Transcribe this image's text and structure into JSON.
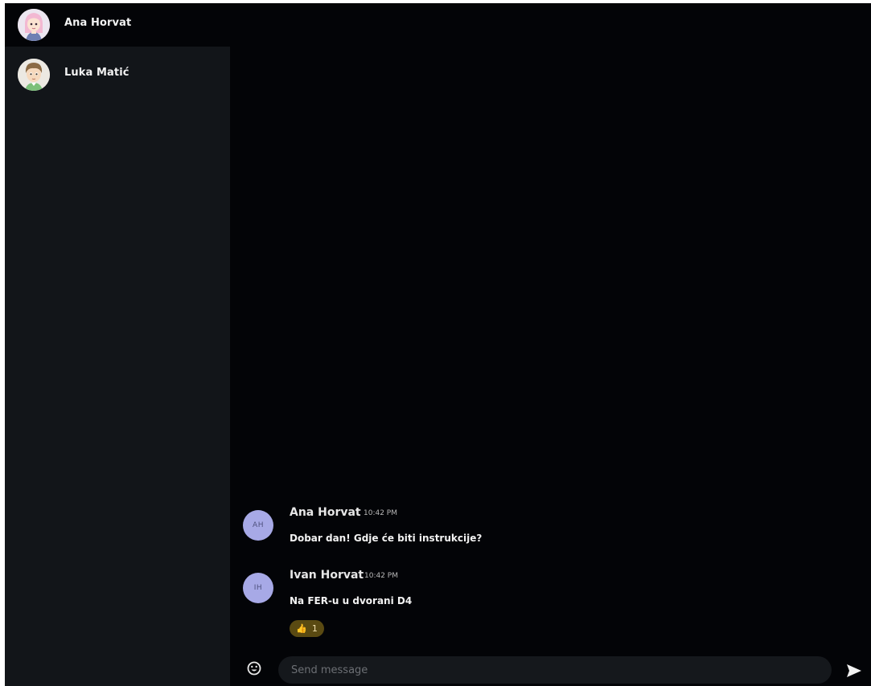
{
  "contacts": [
    {
      "name": "Ana Horvat",
      "avatar_icon": "girl-avatar-icon",
      "active": true
    },
    {
      "name": "Luka Matić",
      "avatar_icon": "boy-avatar-icon",
      "active": false
    }
  ],
  "messages": [
    {
      "initials": "AH",
      "sender": "Ana Horvat",
      "time": "10:42 PM",
      "text": "Dobar dan! Gdje će biti instrukcije?"
    },
    {
      "initials": "IH",
      "sender": "Ivan Horvat",
      "time": "10:42 PM",
      "text": "Na FER-u u dvorani D4",
      "reaction": {
        "emoji": "👍",
        "count": "1"
      }
    }
  ],
  "composer": {
    "placeholder": "Send message",
    "emoji_icon": "smiley-icon",
    "send_icon": "send-icon"
  },
  "colors": {
    "sidebar_bg": "#121519",
    "main_bg": "#030407",
    "avatar_circle": "#a7a9e6",
    "reaction_bg": "#5a4a12"
  }
}
